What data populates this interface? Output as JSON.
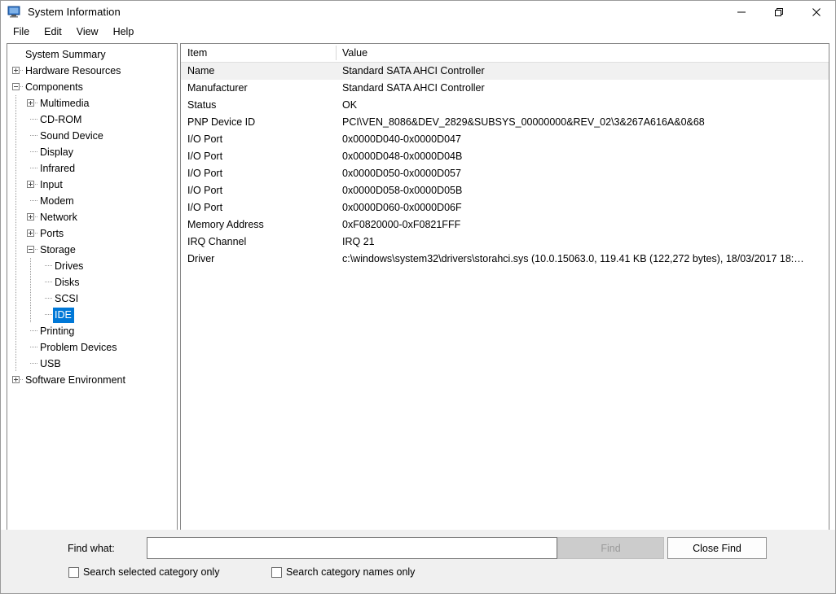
{
  "window": {
    "title": "System Information",
    "icon": "computer-monitor-icon",
    "controls": {
      "minimize": "minimize-icon",
      "restore": "restore-icon",
      "close": "close-icon"
    }
  },
  "menubar": {
    "items": [
      {
        "label": "File"
      },
      {
        "label": "Edit"
      },
      {
        "label": "View"
      },
      {
        "label": "Help"
      }
    ]
  },
  "tree": {
    "nodes": [
      {
        "label": "System Summary",
        "level": 0,
        "expander": "none"
      },
      {
        "label": "Hardware Resources",
        "level": 0,
        "expander": "plus"
      },
      {
        "label": "Components",
        "level": 0,
        "expander": "minus"
      },
      {
        "label": "Multimedia",
        "level": 1,
        "expander": "plus"
      },
      {
        "label": "CD-ROM",
        "level": 1,
        "expander": "none"
      },
      {
        "label": "Sound Device",
        "level": 1,
        "expander": "none"
      },
      {
        "label": "Display",
        "level": 1,
        "expander": "none"
      },
      {
        "label": "Infrared",
        "level": 1,
        "expander": "none"
      },
      {
        "label": "Input",
        "level": 1,
        "expander": "plus"
      },
      {
        "label": "Modem",
        "level": 1,
        "expander": "none"
      },
      {
        "label": "Network",
        "level": 1,
        "expander": "plus"
      },
      {
        "label": "Ports",
        "level": 1,
        "expander": "plus"
      },
      {
        "label": "Storage",
        "level": 1,
        "expander": "minus"
      },
      {
        "label": "Drives",
        "level": 2,
        "expander": "none"
      },
      {
        "label": "Disks",
        "level": 2,
        "expander": "none"
      },
      {
        "label": "SCSI",
        "level": 2,
        "expander": "none"
      },
      {
        "label": "IDE",
        "level": 2,
        "expander": "none",
        "selected": true
      },
      {
        "label": "Printing",
        "level": 1,
        "expander": "none"
      },
      {
        "label": "Problem Devices",
        "level": 1,
        "expander": "none"
      },
      {
        "label": "USB",
        "level": 1,
        "expander": "none"
      },
      {
        "label": "Software Environment",
        "level": 0,
        "expander": "plus"
      }
    ],
    "selection_color": "#0078d7"
  },
  "list": {
    "columns": [
      {
        "label": "Item"
      },
      {
        "label": "Value"
      }
    ],
    "rows": [
      {
        "item": "Name",
        "value": "Standard SATA AHCI Controller",
        "highlight": true
      },
      {
        "item": "Manufacturer",
        "value": "Standard SATA AHCI Controller"
      },
      {
        "item": "Status",
        "value": "OK"
      },
      {
        "item": "PNP Device ID",
        "value": "PCI\\VEN_8086&DEV_2829&SUBSYS_00000000&REV_02\\3&267A616A&0&68"
      },
      {
        "item": "I/O Port",
        "value": "0x0000D040-0x0000D047"
      },
      {
        "item": "I/O Port",
        "value": "0x0000D048-0x0000D04B"
      },
      {
        "item": "I/O Port",
        "value": "0x0000D050-0x0000D057"
      },
      {
        "item": "I/O Port",
        "value": "0x0000D058-0x0000D05B"
      },
      {
        "item": "I/O Port",
        "value": "0x0000D060-0x0000D06F"
      },
      {
        "item": "Memory Address",
        "value": "0xF0820000-0xF0821FFF"
      },
      {
        "item": "IRQ Channel",
        "value": "IRQ 21"
      },
      {
        "item": "Driver",
        "value": "c:\\windows\\system32\\drivers\\storahci.sys (10.0.15063.0, 119.41 KB (122,272 bytes), 18/03/2017 18:…"
      }
    ]
  },
  "findbar": {
    "label": "Find what:",
    "input_value": "",
    "input_placeholder": "",
    "find_button": "Find",
    "find_button_enabled": false,
    "close_find_button": "Close Find",
    "checkbox_selected_category": "Search selected category only",
    "checkbox_selected_category_checked": false,
    "checkbox_category_names": "Search category names only",
    "checkbox_category_names_checked": false
  }
}
